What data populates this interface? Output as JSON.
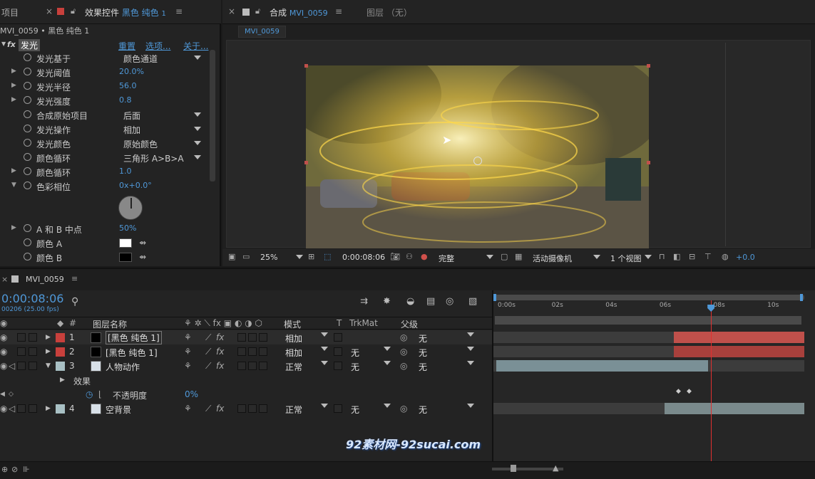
{
  "left_panel": {
    "project_tab": "项目",
    "effect_tab_label": "效果控件",
    "effect_tab_layer": "黑色 纯色",
    "effect_tab_num": "1",
    "breadcrumb": "MVI_0059 • 黑色 纯色 1",
    "effect": {
      "fx": "fx",
      "name": "发光",
      "reset": "重置",
      "options": "选项...",
      "about": "关于..."
    },
    "props": [
      {
        "name": "发光基于",
        "type": "dropdown",
        "value": "颜色通道"
      },
      {
        "name": "发光阈值",
        "type": "num",
        "value": "20.0%"
      },
      {
        "name": "发光半径",
        "type": "num",
        "value": "56.0"
      },
      {
        "name": "发光强度",
        "type": "num",
        "value": "0.8"
      },
      {
        "name": "合成原始项目",
        "type": "dropdown",
        "value": "后面"
      },
      {
        "name": "发光操作",
        "type": "dropdown",
        "value": "相加"
      },
      {
        "name": "发光颜色",
        "type": "dropdown",
        "value": "原始颜色"
      },
      {
        "name": "颜色循环",
        "type": "dropdown",
        "value": "三角形 A>B>A"
      },
      {
        "name": "颜色循环",
        "type": "num",
        "value": "1.0"
      },
      {
        "name": "色彩相位",
        "type": "num",
        "value": "0x+0.0°"
      },
      {
        "name": "A 和 B 中点",
        "type": "num",
        "value": "50%"
      },
      {
        "name": "颜色 A",
        "type": "color",
        "value": "#ffffff"
      },
      {
        "name": "颜色 B",
        "type": "color",
        "value": "#000000"
      }
    ]
  },
  "comp_panel": {
    "tab_label": "合成",
    "tab_comp": "MVI_0059",
    "layer_tab": "图层 （无）",
    "comp_chip": "MVI_0059",
    "zoom": "25%",
    "timecode": "0:00:08:06",
    "quality": "完整",
    "camera": "活动摄像机",
    "views": "1 个视图",
    "exposure": "+0.0"
  },
  "timeline": {
    "tab": "MVI_0059",
    "timecode": "0:00:08:06",
    "frame_info": "00206 (25.00 fps)",
    "col_num": "#",
    "col_name": "图层名称",
    "col_mode": "模式",
    "col_t": "T",
    "col_trkmat": "TrkMat",
    "col_parent": "父级",
    "ruler": [
      "0:00s",
      "02s",
      "04s",
      "06s",
      "08s",
      "10s"
    ],
    "playhead_fraction": 0.7,
    "layers": [
      {
        "num": "1",
        "color": "#c8403c",
        "name": "[黑色 纯色 1]",
        "mode": "相加",
        "trkmat": "",
        "parent": "无",
        "bar_color": "#c0504b",
        "bar_start_fraction": 0.58,
        "bar_end_fraction": 1.0
      },
      {
        "num": "2",
        "color": "#c8403c",
        "name": "[黑色 纯色 1]",
        "mode": "相加",
        "trkmat": "无",
        "parent": "无",
        "bar_color": "#a8403c",
        "bar_start_fraction": 0.58,
        "bar_end_fraction": 1.0
      },
      {
        "num": "3",
        "color": "#a8c0c4",
        "name": "人物动作",
        "mode": "正常",
        "trkmat": "无",
        "parent": "无",
        "bar_color": "#7a9096",
        "bar_start_fraction": 0.01,
        "bar_end_fraction": 0.69
      },
      {
        "num": "4",
        "color": "#a8c0c4",
        "name": "空背景",
        "mode": "正常",
        "trkmat": "无",
        "parent": "无",
        "bar_color": "#7a8a8c",
        "bar_start_fraction": 0.55,
        "bar_end_fraction": 1.0
      }
    ],
    "effects_label": "效果",
    "opacity_label": "不透明度",
    "opacity_value": "0%"
  },
  "watermark": "92素材网-92sucai.com"
}
